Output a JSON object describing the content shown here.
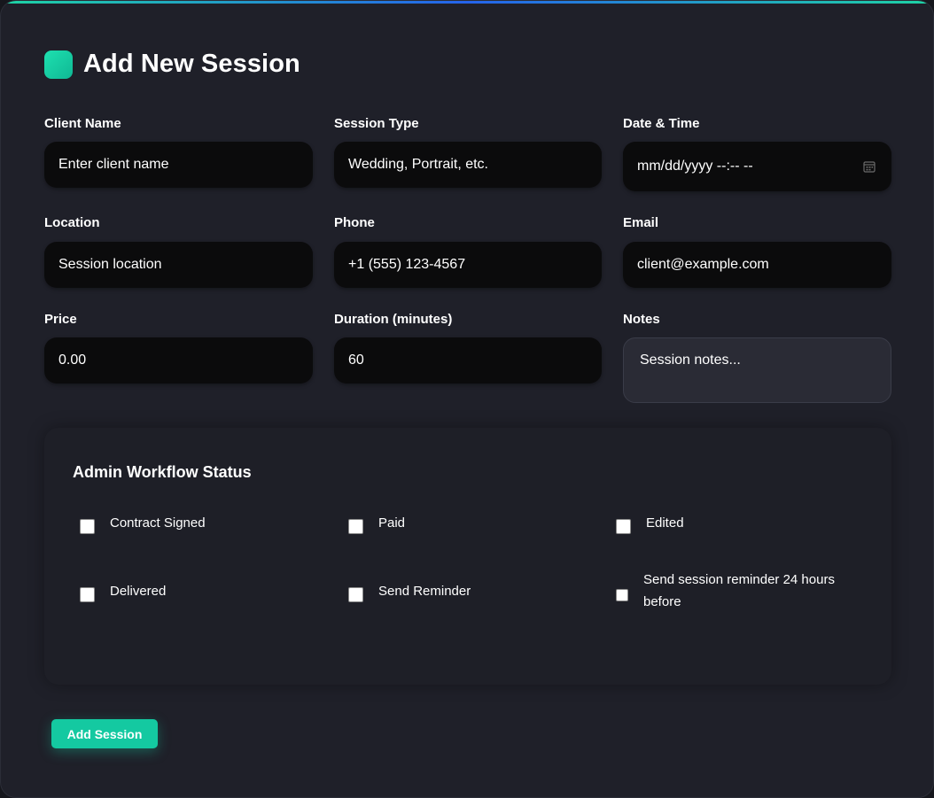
{
  "header": {
    "title": "Add New Session"
  },
  "fields": {
    "client_name": {
      "label": "Client Name",
      "placeholder": "Enter client name"
    },
    "session_type": {
      "label": "Session Type",
      "placeholder": "Wedding, Portrait, etc."
    },
    "date_time": {
      "label": "Date & Time",
      "placeholder": "mm/dd/yyyy --:-- --"
    },
    "location": {
      "label": "Location",
      "placeholder": "Session location"
    },
    "phone": {
      "label": "Phone",
      "placeholder": "+1 (555) 123-4567"
    },
    "email": {
      "label": "Email",
      "placeholder": "client@example.com"
    },
    "price": {
      "label": "Price",
      "placeholder": "0.00"
    },
    "duration": {
      "label": "Duration (minutes)",
      "value": "60"
    },
    "notes": {
      "label": "Notes",
      "placeholder": "Session notes..."
    }
  },
  "workflow": {
    "title": "Admin Workflow Status",
    "items": [
      {
        "label": "Contract Signed",
        "checked": false
      },
      {
        "label": "Paid",
        "checked": false
      },
      {
        "label": "Edited",
        "checked": false
      },
      {
        "label": "Delivered",
        "checked": false
      },
      {
        "label": "Send Reminder",
        "checked": false
      }
    ],
    "reminder_note_line1": "Send session reminder 24 hours",
    "reminder_note_line2": "before"
  },
  "actions": {
    "submit_label": "Add Session"
  },
  "colors": {
    "accent": "#14c9a1",
    "background": "#1f2029",
    "input_bg": "#0b0b0c",
    "text": "#ffffff"
  },
  "icons": {
    "title": "session-badge-icon",
    "date": "calendar-icon"
  }
}
